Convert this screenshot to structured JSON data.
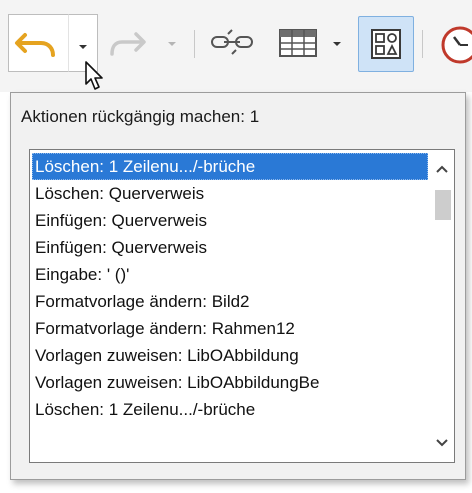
{
  "toolbar": {
    "buttons": [
      {
        "name": "undo",
        "icon": "undo-arrow-icon",
        "state": "pressed"
      },
      {
        "name": "undo-dropdown",
        "icon": "chevron-down-icon"
      },
      {
        "name": "redo",
        "icon": "redo-arrow-icon",
        "state": "disabled"
      },
      {
        "name": "redo-dropdown",
        "icon": "chevron-down-icon",
        "state": "disabled"
      },
      {
        "name": "chain",
        "icon": "chain-link-icon"
      },
      {
        "name": "table",
        "icon": "table-grid-icon"
      },
      {
        "name": "table-dropdown",
        "icon": "chevron-down-icon"
      },
      {
        "name": "shapes",
        "icon": "shapes-icon",
        "state": "active"
      },
      {
        "name": "clock",
        "icon": "clock-icon"
      }
    ],
    "colors": {
      "undo_arrow": "#e5a320",
      "active_bg": "#cfe3f7",
      "active_border": "#7fb0e0"
    }
  },
  "popup": {
    "title": "Aktionen rückgängig machen: 1",
    "selected_index": 0,
    "items": [
      "Löschen: 1 Zeilenu.../-brüche",
      "Löschen: Querverweis",
      "Einfügen: Querverweis",
      "Einfügen: Querverweis",
      "Eingabe: ' ()'",
      "Formatvorlage ändern: Bild2",
      "Formatvorlage ändern: Rahmen12",
      "Vorlagen zuweisen: LibOAbbildung",
      "Vorlagen zuweisen: LibOAbbildungBe",
      "Löschen: 1 Zeilenu.../-brüche"
    ],
    "selection_color": "#2a79d6"
  }
}
